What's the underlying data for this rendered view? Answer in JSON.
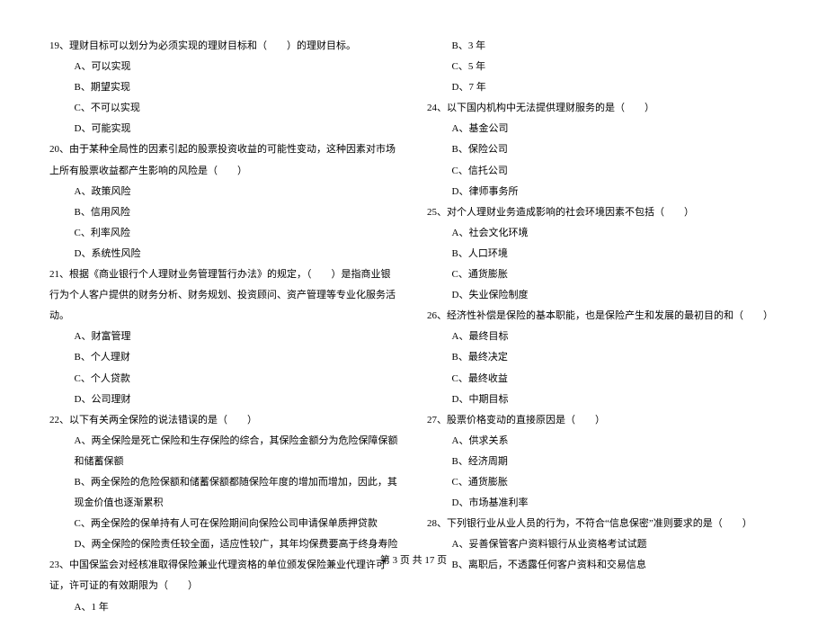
{
  "left": {
    "q19": {
      "stem": "19、理财目标可以划分为必须实现的理财目标和（　　）的理财目标。",
      "A": "A、可以实现",
      "B": "B、期望实现",
      "C": "C、不可以实现",
      "D": "D、可能实现"
    },
    "q20": {
      "stem": "20、由于某种全局性的因素引起的股票投资收益的可能性变动，这种因素对市场上所有股票收益都产生影响的风险是（　　）",
      "A": "A、政策风险",
      "B": "B、信用风险",
      "C": "C、利率风险",
      "D": "D、系统性风险"
    },
    "q21": {
      "stem": "21、根据《商业银行个人理财业务管理暂行办法》的规定，（　　）是指商业银行为个人客户提供的财务分析、财务规划、投资顾问、资产管理等专业化服务活动。",
      "A": "A、财富管理",
      "B": "B、个人理财",
      "C": "C、个人贷款",
      "D": "D、公司理财"
    },
    "q22": {
      "stem": "22、以下有关两全保险的说法错误的是（　　）",
      "A": "A、两全保险是死亡保险和生存保险的综合，其保险金额分为危险保障保额和储蓄保额",
      "B": "B、两全保险的危险保额和储蓄保额都随保险年度的增加而增加，因此，其现金价值也逐渐累积",
      "C": "C、两全保险的保单持有人可在保险期间向保险公司申请保单质押贷款",
      "D": "D、两全保险的保险责任较全面，适应性较广，其年均保费要高于终身寿险"
    },
    "q23": {
      "stem": "23、中国保监会对经核准取得保险兼业代理资格的单位颁发保险兼业代理许可证，许可证的有效期限为（　　）",
      "A": "A、1 年"
    }
  },
  "right": {
    "q23cont": {
      "B": "B、3 年",
      "C": "C、5 年",
      "D": "D、7 年"
    },
    "q24": {
      "stem": "24、以下国内机构中无法提供理财服务的是（　　）",
      "A": "A、基金公司",
      "B": "B、保险公司",
      "C": "C、信托公司",
      "D": "D、律师事务所"
    },
    "q25": {
      "stem": "25、对个人理财业务造成影响的社会环境因素不包括（　　）",
      "A": "A、社会文化环境",
      "B": "B、人口环境",
      "C": "C、通货膨胀",
      "D": "D、失业保险制度"
    },
    "q26": {
      "stem": "26、经济性补偿是保险的基本职能，也是保险产生和发展的最初目的和（　　）",
      "A": "A、最终目标",
      "B": "B、最终决定",
      "C": "C、最终收益",
      "D": "D、中期目标"
    },
    "q27": {
      "stem": "27、股票价格变动的直接原因是（　　）",
      "A": "A、供求关系",
      "B": "B、经济周期",
      "C": "C、通货膨胀",
      "D": "D、市场基准利率"
    },
    "q28": {
      "stem": "28、下列银行业从业人员的行为，不符合“信息保密”准则要求的是（　　）",
      "A": "A、妥善保管客户资料银行从业资格考试试题",
      "B": "B、离职后，不透露任何客户资料和交易信息"
    }
  },
  "footer": "第 3 页 共 17 页"
}
